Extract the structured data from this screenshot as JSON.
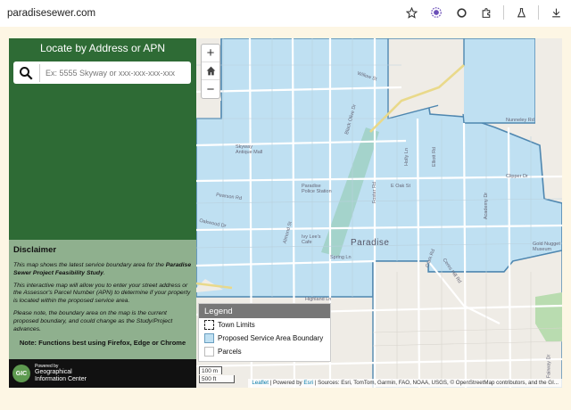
{
  "browser": {
    "url": "paradisesewer.com",
    "icons": [
      "star-icon",
      "extension-flower-icon",
      "circle-extension-icon",
      "puzzle-icon",
      "flask-icon",
      "download-icon"
    ]
  },
  "sidebar": {
    "title": "Locate by Address or APN",
    "search": {
      "placeholder": "Ex: 5555 Skyway or xxx-xxx-xxx-xxx"
    },
    "disclaimer": {
      "title": "Disclaimer",
      "p1_pre": "This map shows the latest service boundary area for the ",
      "p1_bold": "Paradise Sewer Project Feasibility Study",
      "p1_post": ".",
      "p2": "This interactive map will allow you to enter your street address or the Assessor's Parcel Number (APN) to determine if your property is located within the proposed service area.",
      "p3": "Please note, the boundary area on the map is the current proposed boundary, and could change as the Study/Project advances.",
      "note": "Note: Functions best using Firefox, Edge or Chrome"
    },
    "logo": {
      "badge": "GIC",
      "line1": "Powered by",
      "line2": "Geographical",
      "line3": "Information Center"
    }
  },
  "map": {
    "zoom": {
      "in": "+",
      "home": "⌂",
      "out": "−"
    },
    "town_label": "Paradise",
    "labels": {
      "willow": "Willow St",
      "black_olive": "Black Olive Dr",
      "nunneley": "Nunneley Rd",
      "holly": "Holly Ln",
      "elliott": "Elliott Rd",
      "skyway_antique": "Skyway\nAntique Mall",
      "pearson": "Pearson Rd",
      "police": "Paradise\nPolice Station",
      "foster": "Foster Rd",
      "oak": "E Oak St",
      "clipper": "Clipper Dr",
      "academy": "Academy Dr",
      "oakwood": "Oakwood Dr",
      "almond": "Almond St",
      "ivy": "Ivy Lee's\nCafe",
      "spring": "Spring Ln",
      "clark": "Clark Rd",
      "highland": "Highland Ln",
      "ceres": "Ceres Hill Rd",
      "gold": "Gold Nugget\nMuseum",
      "fairway": "Fairway Dr"
    },
    "legend": {
      "title": "Legend",
      "items": [
        "Town Limits",
        "Proposed Service Area Boundary",
        "Parcels"
      ]
    },
    "scale": {
      "metric": "100 m",
      "imperial": "500 ft"
    },
    "attribution": {
      "leaflet": "Leaflet",
      "sep1": " | Powered by ",
      "esri": "Esri",
      "sources": " | Sources: Esri, TomTom, Garmin, FAO, NOAA, USGS, © OpenStreetMap contributors, and the GI..."
    },
    "colors": {
      "service_area": "#bfe0f2",
      "service_border": "#4f87b0",
      "sidebar_green": "#2e6b35"
    }
  }
}
